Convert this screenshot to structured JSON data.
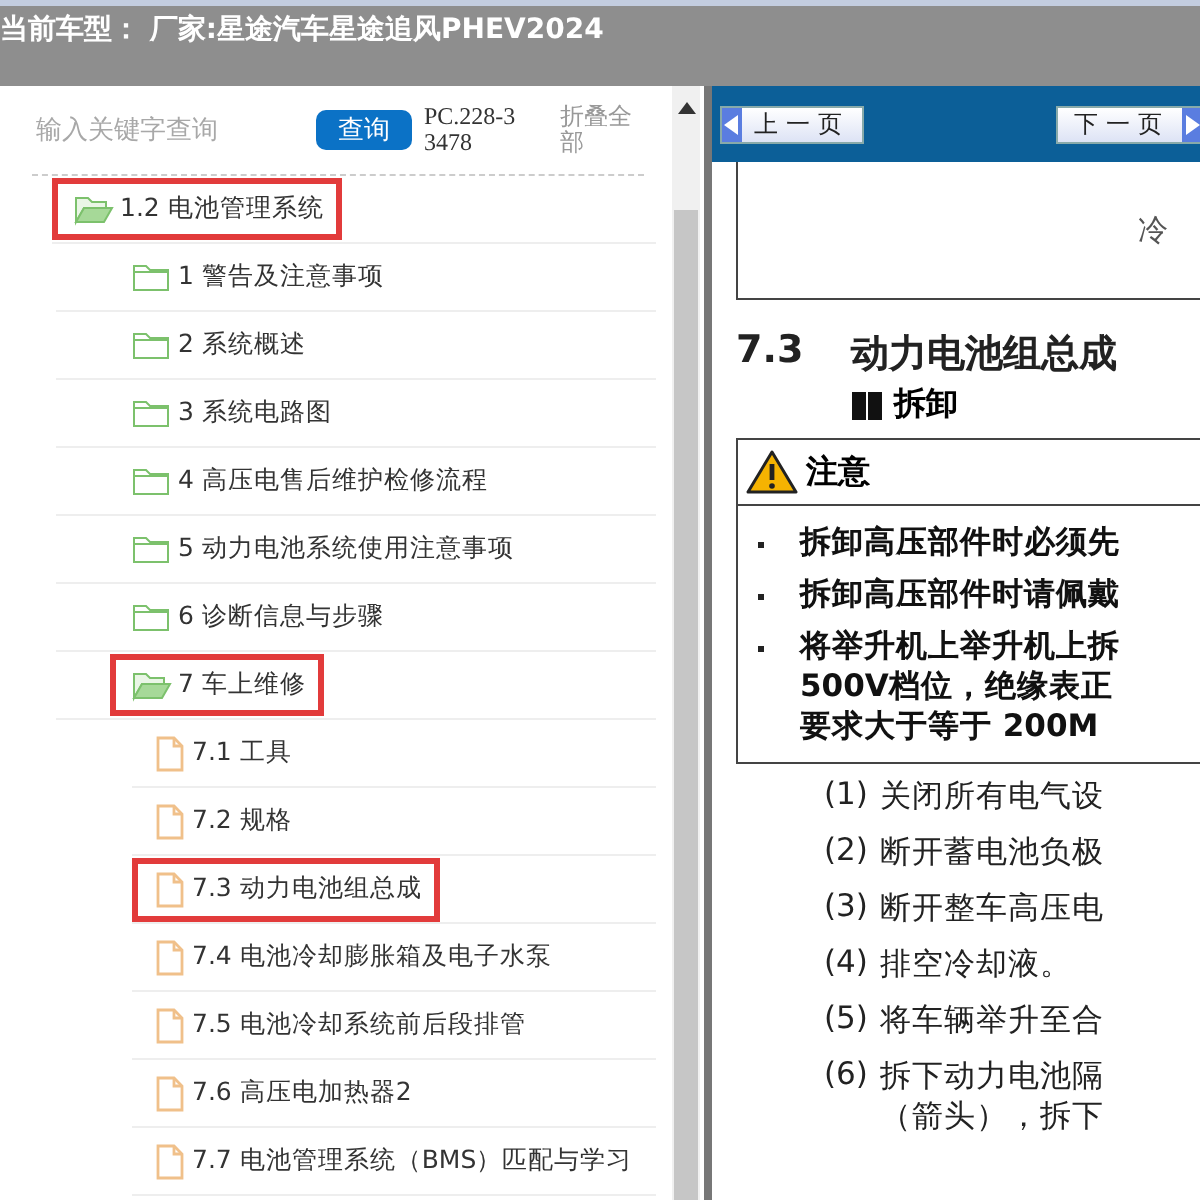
{
  "header": {
    "title": "当前车型： 厂家:星途汽车星途追风PHEV2024"
  },
  "sidebar": {
    "search": {
      "placeholder": "输入关键字查询",
      "button": "查询",
      "code": "PC.228-33478",
      "collapse_link": "折叠全部"
    },
    "tree": [
      {
        "label": "1.2 电池管理系统",
        "kind": "folder",
        "expanded": true,
        "highlighted": true,
        "children": [
          {
            "label": "1 警告及注意事项",
            "kind": "folder",
            "expanded": false,
            "highlighted": false
          },
          {
            "label": "2 系统概述",
            "kind": "folder",
            "expanded": false,
            "highlighted": false
          },
          {
            "label": "3 系统电路图",
            "kind": "folder",
            "expanded": false,
            "highlighted": false
          },
          {
            "label": "4 高压电售后维护检修流程",
            "kind": "folder",
            "expanded": false,
            "highlighted": false
          },
          {
            "label": "5 动力电池系统使用注意事项",
            "kind": "folder",
            "expanded": false,
            "highlighted": false
          },
          {
            "label": "6 诊断信息与步骤",
            "kind": "folder",
            "expanded": false,
            "highlighted": false
          },
          {
            "label": "7 车上维修",
            "kind": "folder",
            "expanded": true,
            "highlighted": true,
            "children": [
              {
                "label": "7.1 工具",
                "kind": "doc",
                "highlighted": false
              },
              {
                "label": "7.2 规格",
                "kind": "doc",
                "highlighted": false
              },
              {
                "label": "7.3 动力电池组总成",
                "kind": "doc",
                "highlighted": true
              },
              {
                "label": "7.4 电池冷却膨胀箱及电子水泵",
                "kind": "doc",
                "highlighted": false
              },
              {
                "label": "7.5 电池冷却系统前后段排管",
                "kind": "doc",
                "highlighted": false
              },
              {
                "label": "7.6 高压电加热器2",
                "kind": "doc",
                "highlighted": false
              },
              {
                "label": "7.7 电池管理系统（BMS）匹配与学习",
                "kind": "doc",
                "highlighted": false
              }
            ]
          }
        ]
      }
    ]
  },
  "document": {
    "nav": {
      "prev": "上一页",
      "next": "下一页"
    },
    "figure_text": "冷",
    "section_number": "7.3",
    "section_title": "动力电池组总成",
    "subheading": "拆卸",
    "notice": {
      "title": "注意",
      "bullets": [
        [
          "拆卸高压部件时必须先"
        ],
        [
          "拆卸高压部件时请佩戴"
        ],
        [
          "将举升机上举升机上拆",
          "500V档位，绝缘表正",
          "要求大于等于 200M"
        ]
      ]
    },
    "steps": [
      {
        "number": "(1)",
        "lines": [
          "关闭所有电气设"
        ]
      },
      {
        "number": "(2)",
        "lines": [
          "断开蓄电池负极"
        ]
      },
      {
        "number": "(3)",
        "lines": [
          "断开整车高压电"
        ]
      },
      {
        "number": "(4)",
        "lines": [
          "排空冷却液。"
        ]
      },
      {
        "number": "(5)",
        "lines": [
          "将车辆举升至合"
        ]
      },
      {
        "number": "(6)",
        "lines": [
          "拆下动力电池隔",
          "（箭头），拆下"
        ]
      }
    ]
  }
}
